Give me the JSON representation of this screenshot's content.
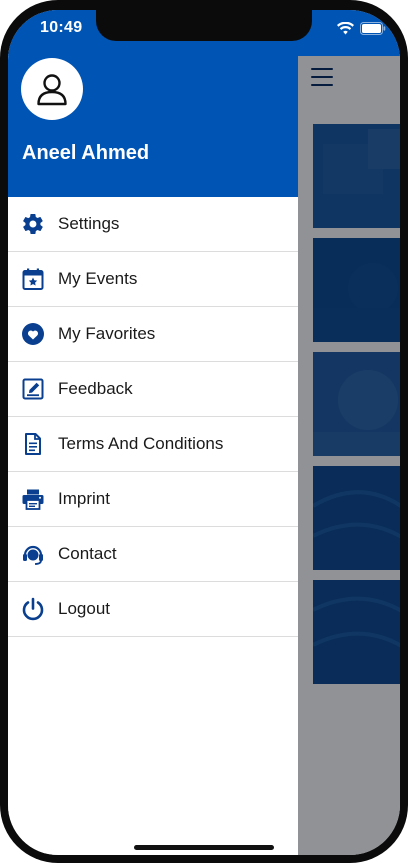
{
  "status_bar": {
    "time": "10:49"
  },
  "user": {
    "name": "Aneel Ahmed"
  },
  "menu": {
    "items": [
      {
        "label": "Settings",
        "icon": "gear-icon"
      },
      {
        "label": "My Events",
        "icon": "calendar-star-icon"
      },
      {
        "label": "My Favorites",
        "icon": "heart-icon"
      },
      {
        "label": "Feedback",
        "icon": "feedback-edit-icon"
      },
      {
        "label": "Terms And Conditions",
        "icon": "document-icon"
      },
      {
        "label": "Imprint",
        "icon": "printer-icon"
      },
      {
        "label": "Contact",
        "icon": "headset-icon"
      },
      {
        "label": "Logout",
        "icon": "power-icon"
      }
    ]
  },
  "colors": {
    "brand_blue": "#0054b4",
    "icon_blue": "#0a3f8f",
    "overlay": "#9a9a9a"
  }
}
